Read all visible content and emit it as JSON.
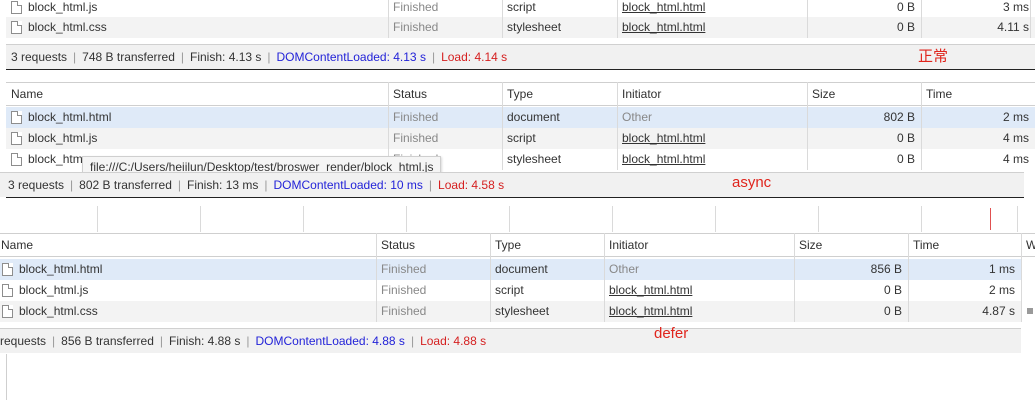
{
  "columns": {
    "name": "Name",
    "status": "Status",
    "type": "Type",
    "initiator": "Initiator",
    "size": "Size",
    "time": "Time",
    "extra": "W"
  },
  "panels": [
    {
      "rows": [
        {
          "name": "block_html.js",
          "status": "Finished",
          "type": "script",
          "initiator": "block_html.html",
          "size": "0 B",
          "time": "3 ms"
        },
        {
          "name": "block_html.css",
          "status": "Finished",
          "type": "stylesheet",
          "initiator": "block_html.html",
          "size": "0 B",
          "time": "4.11 s"
        }
      ],
      "summary": {
        "requests": "3 requests",
        "transferred": "748 B transferred",
        "finish": "Finish: 4.13 s",
        "dcl": "DOMContentLoaded: 4.13 s",
        "load": "Load: 4.14 s"
      },
      "note": "正常"
    },
    {
      "rows": [
        {
          "name": "block_html.html",
          "status": "Finished",
          "type": "document",
          "initiator": "Other",
          "size": "802 B",
          "time": "2 ms"
        },
        {
          "name": "block_html.js",
          "status": "Finished",
          "type": "script",
          "initiator": "block_html.html",
          "size": "0 B",
          "time": "4 ms"
        },
        {
          "name": "block_htm",
          "status": "Finished",
          "type": "stylesheet",
          "initiator": "block_html.html",
          "size": "0 B",
          "time": "4 ms"
        }
      ],
      "tooltip": "file:///C:/Users/heiilun/Desktop/test/broswer_render/block_html.js",
      "summary": {
        "requests": "3 requests",
        "transferred": "802 B transferred",
        "finish": "Finish: 13 ms",
        "dcl": "DOMContentLoaded: 10 ms",
        "load": "Load: 4.58 s"
      },
      "note": "async"
    },
    {
      "rows": [
        {
          "name": "block_html.html",
          "status": "Finished",
          "type": "document",
          "initiator": "Other",
          "size": "856 B",
          "time": "1 ms"
        },
        {
          "name": "block_html.js",
          "status": "Finished",
          "type": "script",
          "initiator": "block_html.html",
          "size": "0 B",
          "time": "2 ms"
        },
        {
          "name": "block_html.css",
          "status": "Finished",
          "type": "stylesheet",
          "initiator": "block_html.html",
          "size": "0 B",
          "time": "4.87 s"
        }
      ],
      "summary": {
        "requests": "requests",
        "transferred": "856 B transferred",
        "finish": "Finish: 4.88 s",
        "dcl": "DOMContentLoaded: 4.88 s",
        "load": "Load: 4.88 s"
      },
      "note": "defer"
    }
  ],
  "colors": {
    "dcl": "#2323d8",
    "load": "#d52020",
    "note": "#e0241c",
    "selected": "#dfeaf8"
  }
}
